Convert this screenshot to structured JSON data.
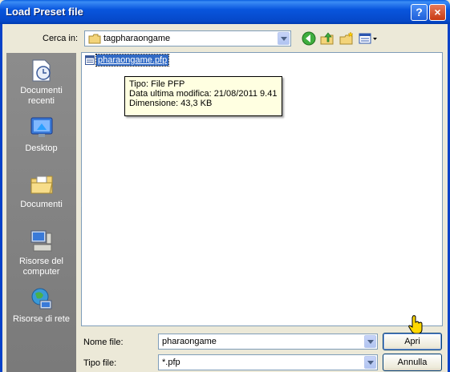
{
  "window": {
    "title": "Load Preset file",
    "help_label": "?",
    "close_label": "×"
  },
  "lookin": {
    "label": "Cerca in:",
    "value": "tagpharaongame"
  },
  "places": [
    {
      "label": "Documenti recenti",
      "icon": "recent-documents-icon"
    },
    {
      "label": "Desktop",
      "icon": "desktop-icon"
    },
    {
      "label": "Documenti",
      "icon": "documents-folder-icon"
    },
    {
      "label": "Risorse del computer",
      "icon": "my-computer-icon"
    },
    {
      "label": "Risorse di rete",
      "icon": "network-icon"
    }
  ],
  "files": [
    {
      "name": "pharaongame.pfp",
      "icon": "pfp-file-icon"
    }
  ],
  "tooltip": {
    "line1": "Tipo: File PFP",
    "line2": "Data ultima modifica: 21/08/2011 9.41",
    "line3": "Dimensione: 43,3 KB"
  },
  "filename": {
    "label": "Nome file:",
    "value": "pharaongame"
  },
  "filetype": {
    "label": "Tipo file:",
    "value": "*.pfp"
  },
  "buttons": {
    "open": "Apri",
    "cancel": "Annulla"
  },
  "toolbar": [
    "back-icon",
    "up-folder-icon",
    "new-folder-icon",
    "view-menu-icon"
  ]
}
